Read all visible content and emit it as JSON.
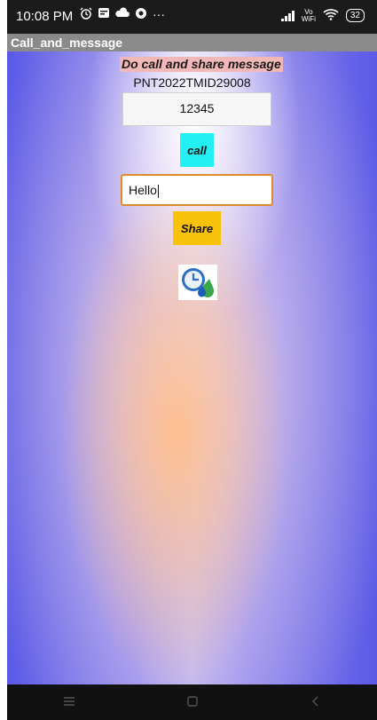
{
  "status_bar": {
    "time": "10:08 PM",
    "icons_left": [
      "alarm-icon",
      "notification-icon",
      "cloud-icon",
      "browser-icon",
      "more-icon"
    ],
    "more": "···",
    "vowifi_top": "Vo",
    "vowifi_bottom": "WiFi",
    "battery": "32"
  },
  "app_bar": {
    "title": "Call_and_message"
  },
  "main": {
    "heading": "Do call and share message",
    "id_text": "PNT2022TMID29008",
    "number_value": "12345",
    "call_label": "call",
    "message_value": "Hello",
    "share_label": "Share",
    "app_icon": "clock-drop-icon"
  },
  "colors": {
    "call_button": "#22f0f3",
    "share_button": "#f9c20a",
    "heading_bg": "#f2b7b7",
    "field_focus_border": "#e08a2c",
    "background_edge": "#5a5ae6"
  },
  "nav_bar": {
    "items": [
      "menu-icon",
      "home-icon",
      "back-icon"
    ]
  }
}
